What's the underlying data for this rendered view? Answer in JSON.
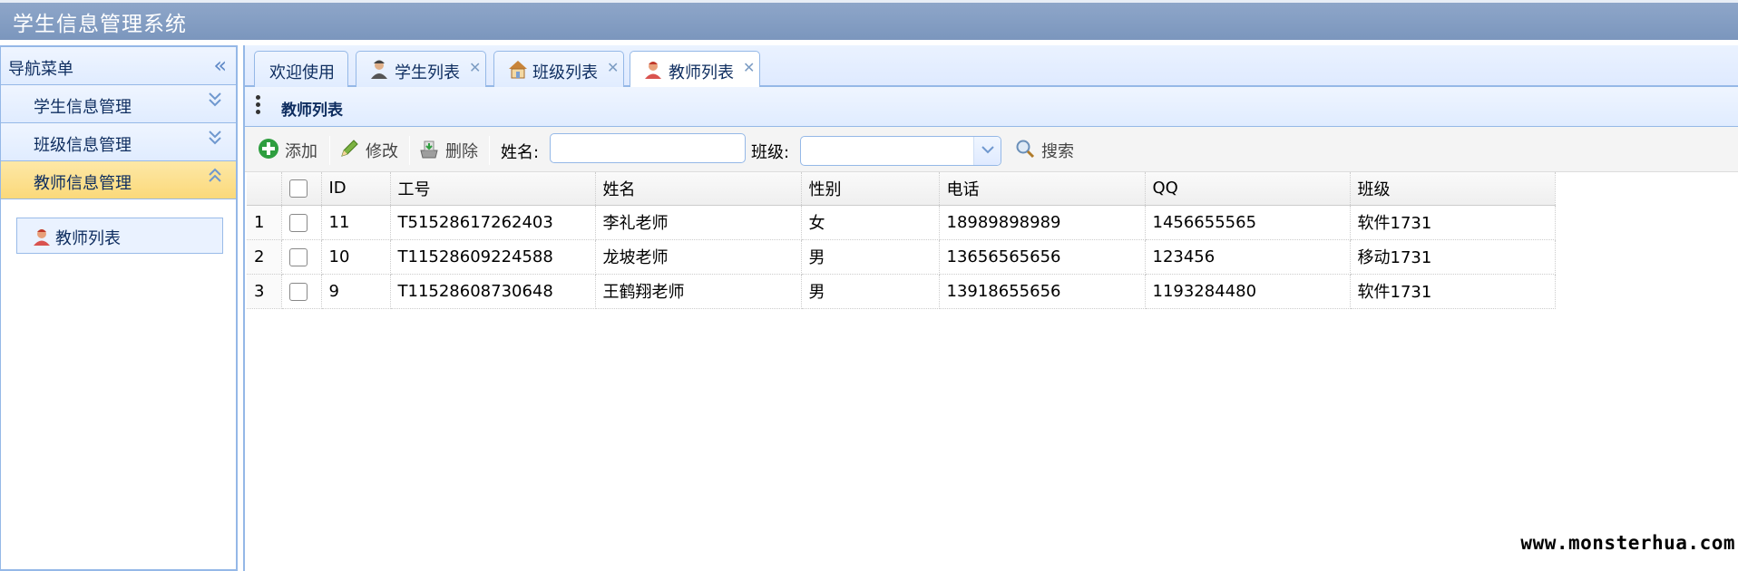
{
  "app": {
    "title": "学生信息管理系统"
  },
  "sidebar": {
    "header": "导航菜单",
    "groups": [
      {
        "label": "学生信息管理",
        "expanded": false
      },
      {
        "label": "班级信息管理",
        "expanded": false
      },
      {
        "label": "教师信息管理",
        "expanded": true
      }
    ],
    "items": [
      {
        "label": "教师列表",
        "icon": "teacher-icon"
      }
    ]
  },
  "tabs": [
    {
      "label": "欢迎使用",
      "closable": false
    },
    {
      "label": "学生列表",
      "closable": true,
      "icon": "student-icon"
    },
    {
      "label": "班级列表",
      "closable": true,
      "icon": "house-icon"
    },
    {
      "label": "教师列表",
      "closable": true,
      "icon": "teacher-icon",
      "selected": true
    }
  ],
  "panel": {
    "title": "教师列表"
  },
  "toolbar": {
    "add_label": "添加",
    "edit_label": "修改",
    "delete_label": "删除",
    "name_label": "姓名:",
    "name_value": "",
    "class_label": "班级:",
    "class_value": "",
    "search_label": "搜索"
  },
  "table": {
    "columns": [
      "ID",
      "工号",
      "姓名",
      "性别",
      "电话",
      "QQ",
      "班级"
    ],
    "rows": [
      {
        "num": "1",
        "id": "11",
        "sn": "T51528617262403",
        "name": "李礼老师",
        "sex": "女",
        "phone": "18989898989",
        "qq": "1456655565",
        "cls": "软件1731"
      },
      {
        "num": "2",
        "id": "10",
        "sn": "T11528609224588",
        "name": "龙坡老师",
        "sex": "男",
        "phone": "13656565656",
        "qq": "123456",
        "cls": "移动1731"
      },
      {
        "num": "3",
        "id": "9",
        "sn": "T11528608730648",
        "name": "王鹤翔老师",
        "sex": "男",
        "phone": "13918655656",
        "qq": "1193284480",
        "cls": "软件1731"
      }
    ]
  },
  "watermark": "www.monsterhua.com",
  "colors": {
    "titlebar": "#7f99c0",
    "border": "#95b8e7",
    "active_group": "#fbd97a"
  }
}
